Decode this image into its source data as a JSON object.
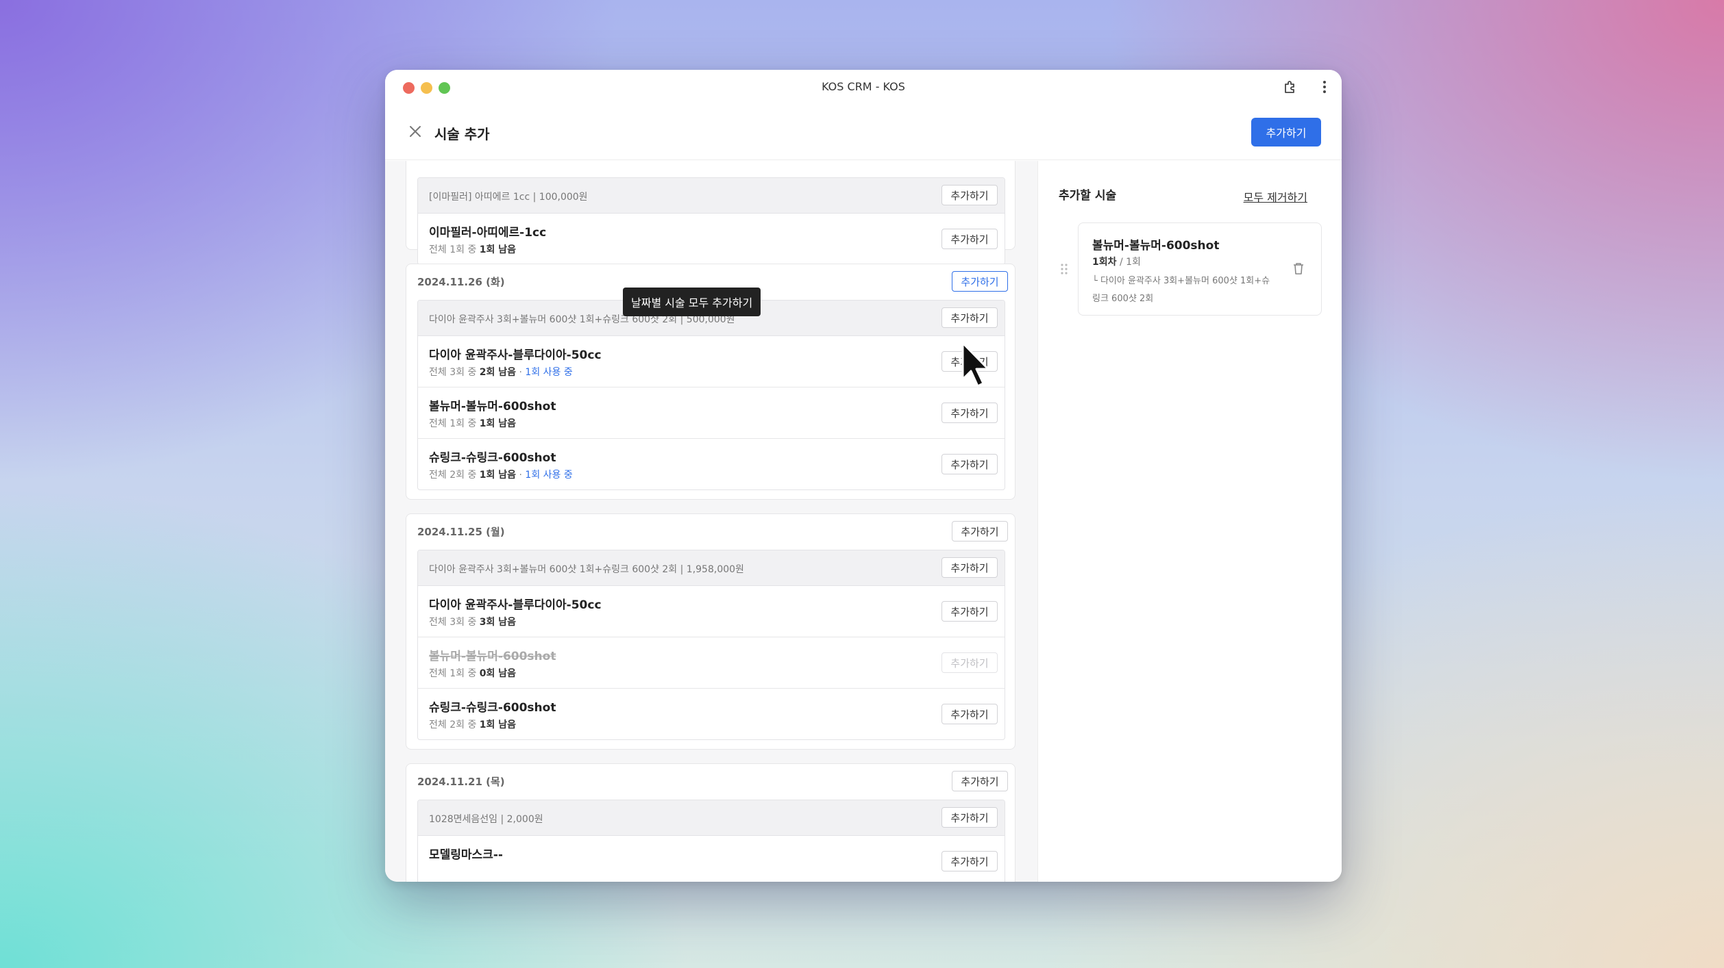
{
  "window": {
    "title": "KOS CRM - KOS"
  },
  "header": {
    "title": "시술 추가",
    "primary_button": "추가하기"
  },
  "tooltip": "날짜별 시술 모두 추가하기",
  "sections": [
    {
      "date": "",
      "package": {
        "label": "[이마필러] 아띠에르 1cc  |  100,000원",
        "button": "추가하기"
      },
      "items": [
        {
          "name": "이마필러-아띠에르-1cc",
          "total": "전체 1회 중",
          "remaining": "1회 남음",
          "in_use": "",
          "button": "추가하기"
        }
      ]
    },
    {
      "date": "2024.11.26 (화)",
      "date_button": "추가하기",
      "package": {
        "label": "다이아 윤곽주사 3회+볼뉴머 600샷 1회+슈링크 600샷 2회  |  500,000원",
        "button": "추가하기"
      },
      "items": [
        {
          "name": "다이아 윤곽주사-블루다이아-50cc",
          "total": "전체 3회 중",
          "remaining": "2회 남음",
          "in_use": "1회 사용 중",
          "button": "추가하기"
        },
        {
          "name": "볼뉴머-볼뉴머-600shot",
          "total": "전체 1회 중",
          "remaining": "1회 남음",
          "in_use": "",
          "button": "추가하기"
        },
        {
          "name": "슈링크-슈링크-600shot",
          "total": "전체 2회 중",
          "remaining": "1회 남음",
          "in_use": "1회 사용 중",
          "button": "추가하기"
        }
      ]
    },
    {
      "date": "2024.11.25 (월)",
      "date_button": "추가하기",
      "package": {
        "label": "다이아 윤곽주사 3회+볼뉴머 600샷 1회+슈링크 600샷 2회  |  1,958,000원",
        "button": "추가하기"
      },
      "items": [
        {
          "name": "다이아 윤곽주사-블루다이아-50cc",
          "total": "전체 3회 중",
          "remaining": "3회 남음",
          "in_use": "",
          "button": "추가하기"
        },
        {
          "name": "볼뉴머-볼뉴머-600shot",
          "total": "전체 1회 중",
          "remaining": "0회 남음",
          "in_use": "",
          "button": "추가하기",
          "disabled": true
        },
        {
          "name": "슈링크-슈링크-600shot",
          "total": "전체 2회 중",
          "remaining": "1회 남음",
          "in_use": "",
          "button": "추가하기"
        }
      ]
    },
    {
      "date": "2024.11.21 (목)",
      "date_button": "추가하기",
      "package": {
        "label": "1028면세음선임  |  2,000원",
        "button": "추가하기"
      },
      "items": [
        {
          "name": "모델링마스크--",
          "button": "추가하기"
        }
      ]
    }
  ],
  "right_panel": {
    "title": "추가할 시술",
    "clear_all": "모두 제거하기",
    "selected": {
      "name": "볼뉴머-볼뉴머-600shot",
      "round": "1회차",
      "round_total": "/ 1회",
      "package": "다이아 윤곽주사 3회+볼뉴머 600샷 1회+슈링크 600샷 2회"
    }
  },
  "colors": {
    "accent": "#2f6fe8",
    "tooltip_bg": "#222222"
  },
  "icons": [
    "close-icon",
    "extension-icon",
    "more-vertical-icon",
    "trash-icon",
    "drag-handle-icon",
    "cursor-icon"
  ]
}
